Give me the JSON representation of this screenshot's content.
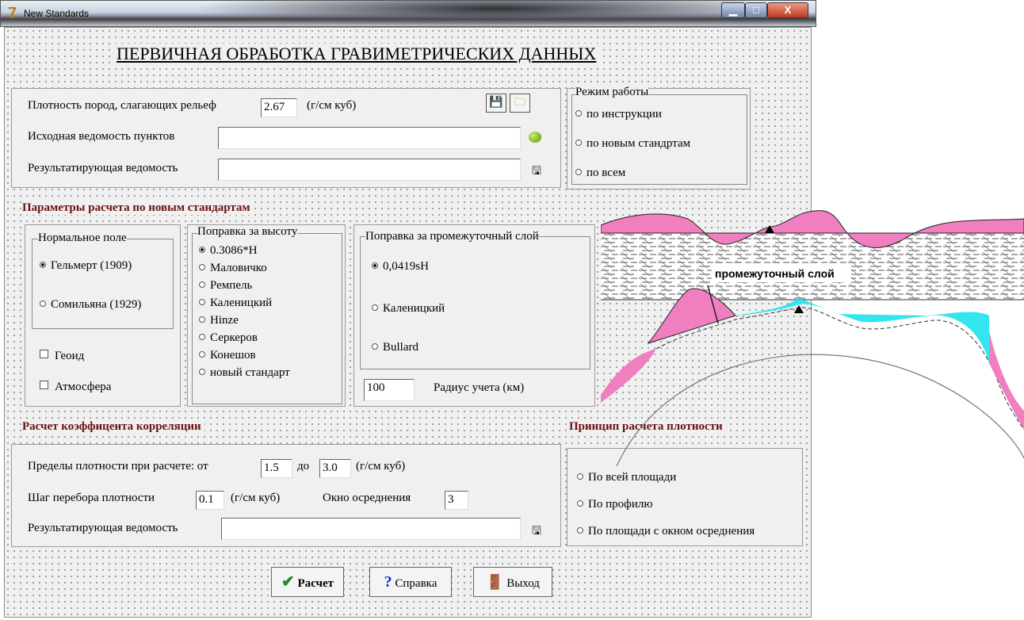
{
  "window": {
    "title": "New Standards",
    "app_icon": "7",
    "min": "▁",
    "max": "□",
    "close": "X"
  },
  "heading": "ПЕРВИЧНАЯ ОБРАБОТКА ГРАВИМЕТРИЧЕСКИХ ДАННЫХ",
  "top": {
    "density_label": "Плотность пород, слагающих рельеф",
    "density_value": "2.67",
    "density_unit": "(г/см куб)",
    "source_label": "Исходная ведомость пунктов",
    "source_value": "",
    "result_label": "Результатирующая ведомость",
    "result_value": ""
  },
  "mode": {
    "title": "Режим работы",
    "options": [
      "по инструкции",
      "по новым стандртам",
      "по всем"
    ],
    "selected": -1
  },
  "params_header": "Параметры расчета по новым стандартам",
  "normal_field": {
    "title": "Нормальное поле",
    "options": [
      "Гельмерт (1909)",
      "Сомильяна (1929)"
    ],
    "selected": 0
  },
  "checkboxes": [
    "Геоид",
    "Атмосфера"
  ],
  "height_corr": {
    "title": "Поправка за высоту",
    "options": [
      "0.3086*H",
      "Маловичко",
      "Ремпель",
      "Каленицкий",
      "Hinze",
      "Серкеров",
      "Конешов",
      "новый стандарт"
    ],
    "selected": 0
  },
  "layer_corr": {
    "title": "Поправка за промежуточный слой",
    "options": [
      "0,0419sH",
      "Каленицкий",
      "Bullard"
    ],
    "selected": 0,
    "radius_value": "100",
    "radius_label": "Радиус учета (км)"
  },
  "diagram_label": "промежуточный слой",
  "corr_header": "Расчет коэффицента корреляции",
  "corr": {
    "limits_label": "Пределы плотности при расчете: от",
    "from_value": "1.5",
    "to_label": "до",
    "to_value": "3.0",
    "unit": "(г/см куб)",
    "step_label": "Шаг перебора плотности",
    "step_value": "0.1",
    "step_unit": "(г/см куб)",
    "window_label": "Окно осреднения",
    "window_value": "3",
    "result_label": "Результатирующая ведомость",
    "result_value": ""
  },
  "principle_header": "Принцип расчета плотности",
  "principle": {
    "options": [
      "По всей площади",
      "По профилю",
      "По площади с окном осреднения"
    ],
    "selected": -1
  },
  "buttons": {
    "calc": "Расчет",
    "help": "Справка",
    "exit": "Выход"
  },
  "colors": {
    "header": "#6b1010",
    "pink": "#f07fc0",
    "cyan": "#27e4ee",
    "check": "#1e8c1e",
    "help": "#1a2fd0"
  }
}
